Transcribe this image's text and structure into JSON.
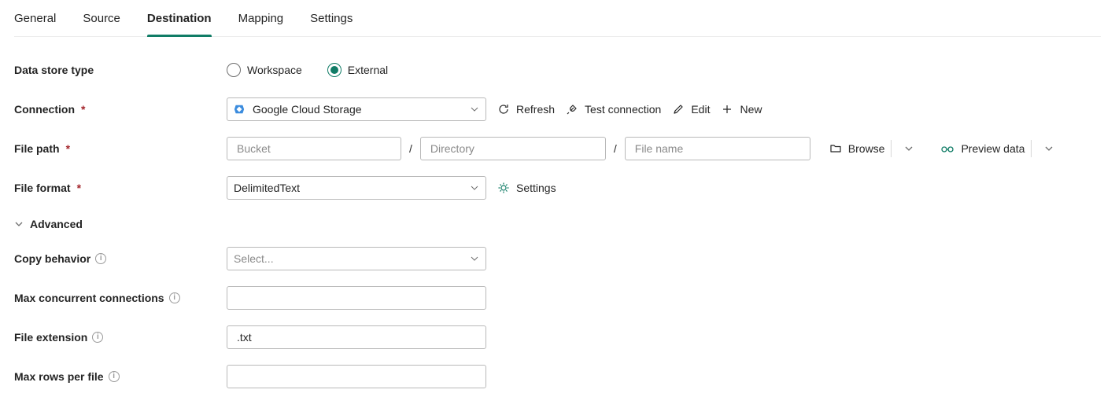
{
  "tabs": {
    "t0": "General",
    "t1": "Source",
    "t2": "Destination",
    "t3": "Mapping",
    "t4": "Settings",
    "active": "Destination"
  },
  "labels": {
    "data_store_type": "Data store type",
    "connection": "Connection",
    "file_path": "File path",
    "file_format": "File format",
    "advanced": "Advanced",
    "copy_behavior": "Copy behavior",
    "max_concurrent": "Max concurrent connections",
    "file_extension": "File extension",
    "max_rows": "Max rows per file"
  },
  "data_store": {
    "workspace": "Workspace",
    "external": "External"
  },
  "connection": {
    "selected": "Google Cloud Storage",
    "actions": {
      "refresh": "Refresh",
      "test": "Test connection",
      "edit": "Edit",
      "new": "New"
    }
  },
  "file_path": {
    "bucket_ph": "Bucket",
    "dir_ph": "Directory",
    "file_ph": "File name",
    "browse": "Browse",
    "preview": "Preview data"
  },
  "file_format": {
    "selected": "DelimitedText",
    "settings": "Settings"
  },
  "advanced": {
    "copy_behavior_ph": "Select...",
    "max_concurrent_value": "",
    "file_extension_value": ".txt",
    "max_rows_value": ""
  }
}
